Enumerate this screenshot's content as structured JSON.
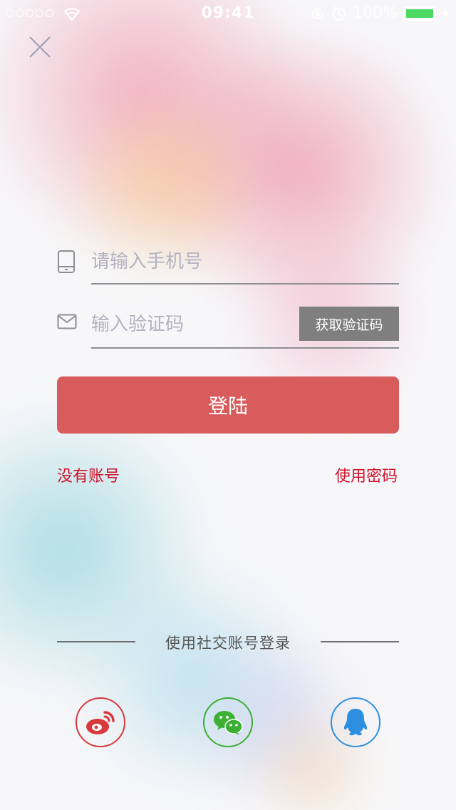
{
  "status_bar": {
    "signal_dots": 5,
    "time": "09:41",
    "battery_percent": "100%",
    "battery_fill": 1.0,
    "icons": [
      "signal-dots-icon",
      "wifi-icon",
      "rotation-lock-icon",
      "alarm-icon",
      "battery-icon",
      "charging-icon"
    ]
  },
  "header": {
    "close_icon": "close-icon"
  },
  "form": {
    "phone": {
      "icon": "phone-icon",
      "placeholder": "请输入手机号",
      "value": ""
    },
    "code": {
      "icon": "envelope-icon",
      "placeholder": "输入验证码",
      "value": "",
      "get_code_label": "获取验证码"
    },
    "login_label": "登陆"
  },
  "links": {
    "register": "没有账号",
    "use_password": "使用密码"
  },
  "social": {
    "title": "使用社交账号登录",
    "providers": [
      {
        "icon": "weibo-icon",
        "color": "#d7393c"
      },
      {
        "icon": "wechat-icon",
        "color": "#3cb034"
      },
      {
        "icon": "qq-icon",
        "color": "#2e8fe0"
      }
    ]
  },
  "colors": {
    "accent": "#d95c5c",
    "link": "#d0112b",
    "code_button": "#7f7f7f",
    "battery": "#4cd964"
  }
}
